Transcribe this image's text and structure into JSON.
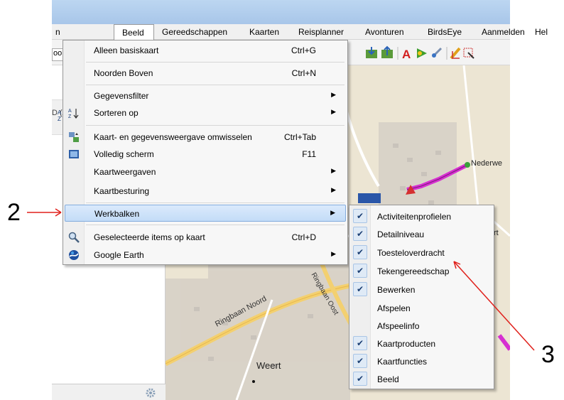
{
  "menubar": {
    "partial_left": "n",
    "items": [
      "Beeld",
      "Gereedschappen",
      "Kaarten",
      "Reisplanner",
      "Avonturen",
      "BirdsEye",
      "Aanmelden",
      "Hel"
    ]
  },
  "toolbar": {
    "partial_text": "oo"
  },
  "left_pane": {
    "partial_text": "D (/",
    "sort_icon": "sort-az-icon"
  },
  "map": {
    "labels": [
      "Nederwe",
      "Ringbaan Noord",
      "Ringbaan Oost",
      "N2",
      "Weert",
      "rt"
    ]
  },
  "dropdown": {
    "items": [
      {
        "label": "Alleen basiskaart",
        "shortcut": "Ctrl+G",
        "submenu": false,
        "icon": ""
      },
      {
        "label": "Noorden Boven",
        "shortcut": "Ctrl+N",
        "submenu": false,
        "icon": ""
      },
      {
        "label": "Gegevensfilter",
        "shortcut": "",
        "submenu": true,
        "icon": ""
      },
      {
        "label": "Sorteren op",
        "shortcut": "",
        "submenu": true,
        "icon": "sort-az-icon"
      },
      {
        "label": "Kaart- en gegevensweergave omwisselen",
        "shortcut": "Ctrl+Tab",
        "submenu": false,
        "icon": "swap-view-icon"
      },
      {
        "label": "Volledig scherm",
        "shortcut": "F11",
        "submenu": false,
        "icon": "fullscreen-icon"
      },
      {
        "label": "Kaartweergaven",
        "shortcut": "",
        "submenu": true,
        "icon": ""
      },
      {
        "label": "Kaartbesturing",
        "shortcut": "",
        "submenu": true,
        "icon": ""
      },
      {
        "label": "Werkbalken",
        "shortcut": "",
        "submenu": true,
        "icon": "",
        "highlighted": true
      },
      {
        "label": "Geselecteerde items op kaart",
        "shortcut": "Ctrl+D",
        "submenu": false,
        "icon": "magnifier-map-icon"
      },
      {
        "label": "Google Earth",
        "shortcut": "",
        "submenu": true,
        "icon": "google-earth-icon"
      }
    ]
  },
  "submenu": {
    "items": [
      {
        "label": "Activiteitenprofielen",
        "checked": true
      },
      {
        "label": "Detailniveau",
        "checked": true
      },
      {
        "label": "Toesteloverdracht",
        "checked": true
      },
      {
        "label": "Tekengereedschap",
        "checked": true
      },
      {
        "label": "Bewerken",
        "checked": true
      },
      {
        "label": "Afspelen",
        "checked": false
      },
      {
        "label": "Afspeelinfo",
        "checked": false
      },
      {
        "label": "Kaartproducten",
        "checked": true
      },
      {
        "label": "Kaartfuncties",
        "checked": true
      },
      {
        "label": "Beeld",
        "checked": true
      }
    ]
  },
  "callouts": {
    "left": "2",
    "right": "3"
  },
  "colors": {
    "highlight": "#c3dcf7",
    "arrow": "#e0201b",
    "route": "#d62fd1",
    "check": "#1b3f73"
  }
}
